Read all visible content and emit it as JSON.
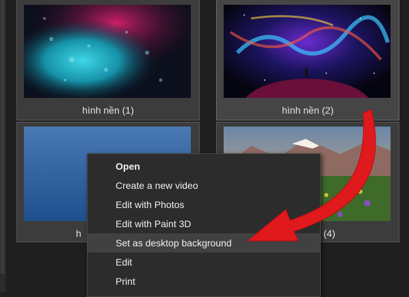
{
  "tiles": [
    {
      "caption": "hình nền (1)"
    },
    {
      "caption": "hình nền (2)"
    },
    {
      "caption": "h"
    },
    {
      "caption": "(4)"
    }
  ],
  "context_menu": {
    "items": [
      {
        "label": "Open"
      },
      {
        "label": "Create a new video"
      },
      {
        "label": "Edit with Photos"
      },
      {
        "label": "Edit with Paint 3D"
      },
      {
        "label": "Set as desktop background"
      },
      {
        "label": "Edit"
      },
      {
        "label": "Print"
      }
    ]
  },
  "colors": {
    "background": "#1f1f1f",
    "menu_background": "#2c2c2c",
    "menu_hover": "#414141",
    "annotation_arrow": "#e0191c"
  }
}
